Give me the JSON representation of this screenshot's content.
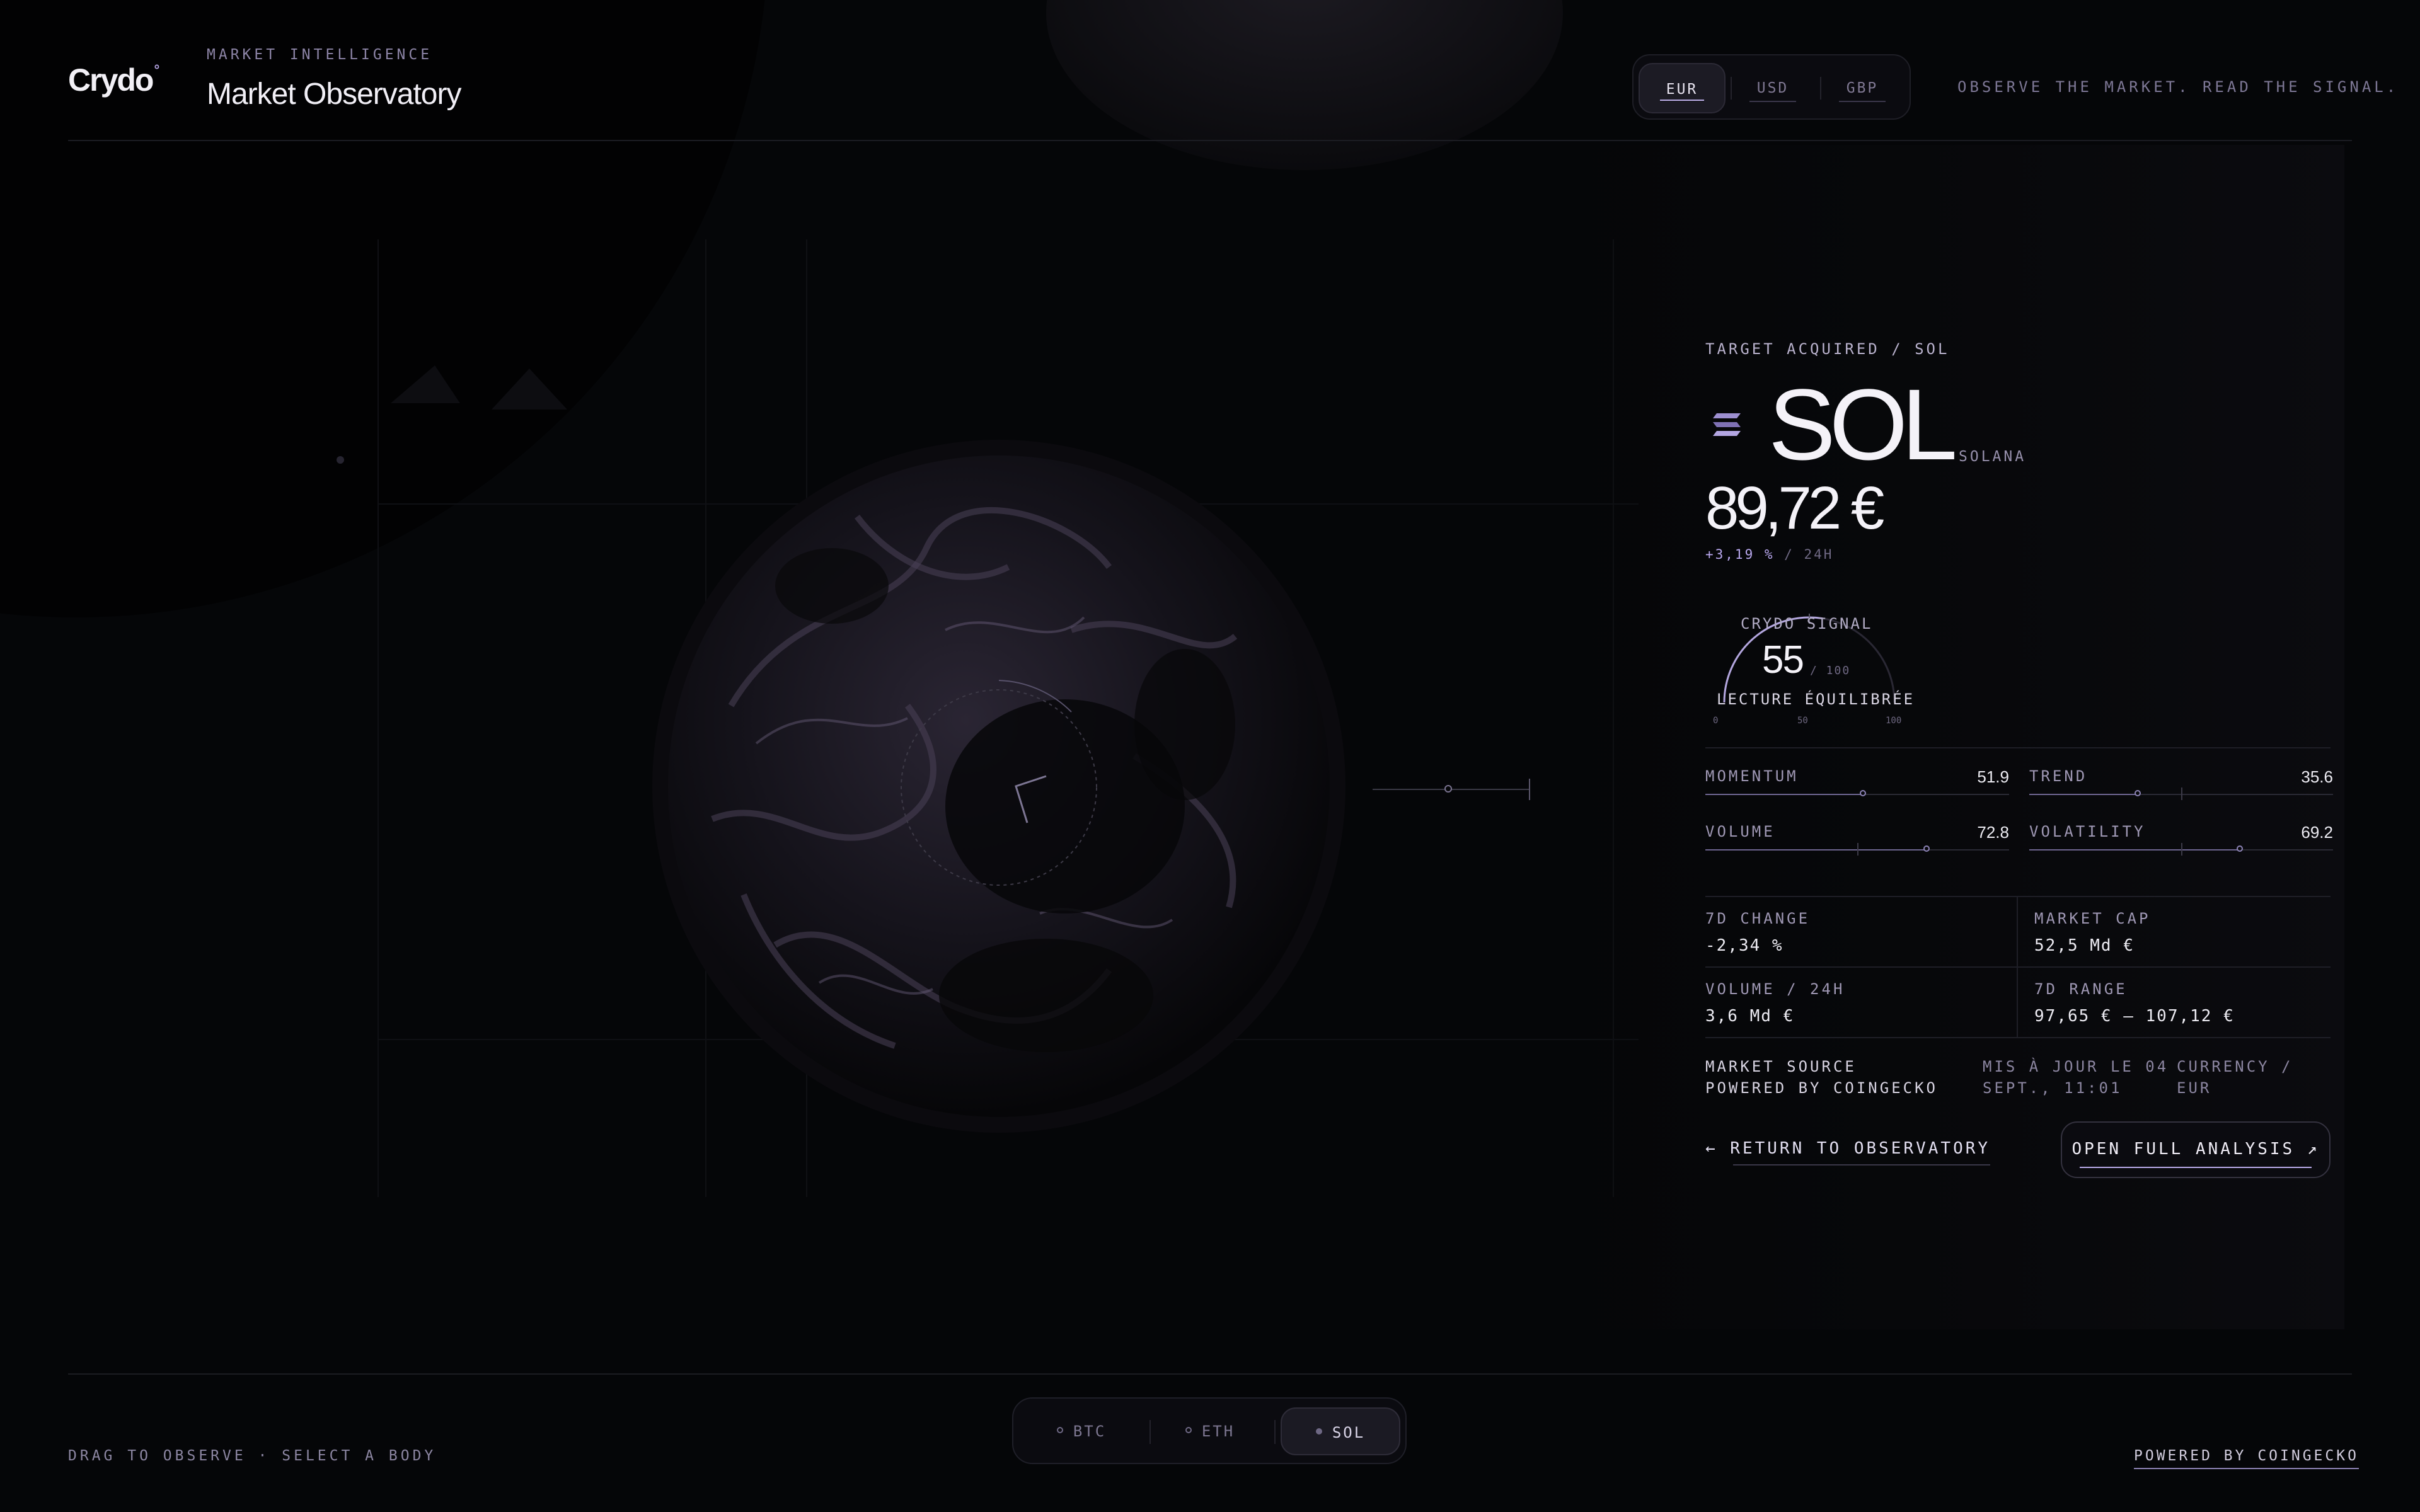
{
  "header": {
    "logo": "Crydo",
    "logo_mark": "°",
    "eyebrow": "MARKET INTELLIGENCE",
    "title": "Market Observatory",
    "currencies": [
      {
        "label": "EUR",
        "active": true
      },
      {
        "label": "USD",
        "active": false
      },
      {
        "label": "GBP",
        "active": false
      }
    ],
    "tagline": "OBSERVE THE MARKET. READ THE SIGNAL."
  },
  "asset": {
    "eyebrow": "TARGET ACQUIRED / SOL",
    "symbol": "SOL",
    "name": "SOLANA",
    "icon": "solana-icon",
    "price": "89,72 €",
    "change": "+3,19 %",
    "change_period": "/ 24H"
  },
  "signal": {
    "label": "CRYDO SIGNAL",
    "value": "55",
    "out_of": "/ 100",
    "reading": "LECTURE ÉQUILIBRÉE",
    "scale": [
      "0",
      "50",
      "100"
    ],
    "level": 0.55
  },
  "metrics": [
    {
      "label": "MOMENTUM",
      "value": "51.9",
      "level": 0.519
    },
    {
      "label": "TREND",
      "value": "35.6",
      "level": 0.356
    },
    {
      "label": "VOLUME",
      "value": "72.8",
      "level": 0.728
    },
    {
      "label": "VOLATILITY",
      "value": "69.2",
      "level": 0.692
    }
  ],
  "stats": [
    {
      "label": "7D CHANGE",
      "value": "-2,34 %"
    },
    {
      "label": "MARKET CAP",
      "value": "52,5 Md €"
    },
    {
      "label": "VOLUME / 24H",
      "value": "3,6 Md €"
    },
    {
      "label": "7D RANGE",
      "value": "97,65 € – 107,12 €"
    }
  ],
  "source": {
    "label": "MARKET SOURCE",
    "provider": "POWERED BY COINGECKO",
    "updated_line1": "MIS À JOUR LE 04",
    "updated_line2": "SEPT., 11:01",
    "currency": "CURRENCY / EUR"
  },
  "actions": {
    "return": "← RETURN TO OBSERVATORY",
    "open": "OPEN FULL ANALYSIS ↗"
  },
  "footer": {
    "hint": "DRAG TO OBSERVE · SELECT A BODY",
    "assets": [
      {
        "label": "BTC",
        "active": false
      },
      {
        "label": "ETH",
        "active": false
      },
      {
        "label": "SOL",
        "active": true
      }
    ],
    "powered": "POWERED BY COINGECKO"
  },
  "colors": {
    "background": "#050608",
    "accent": "#b8a9e8",
    "text": "#f4f2f8"
  }
}
